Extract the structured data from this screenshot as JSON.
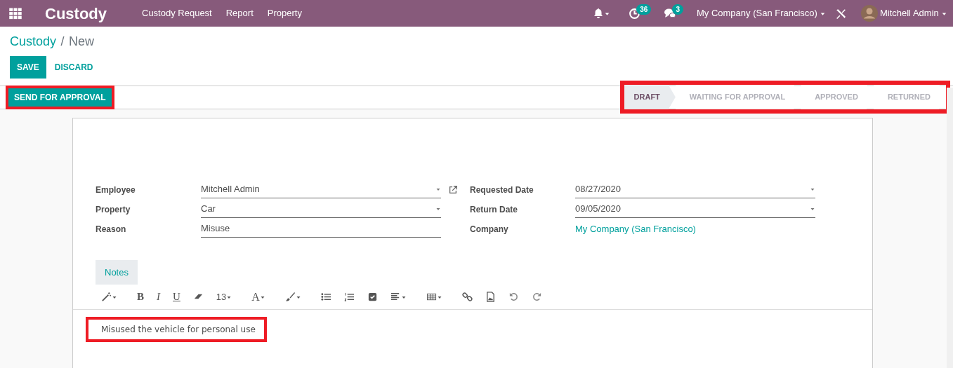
{
  "navbar": {
    "app_title": "Custody",
    "menu": [
      "Custody Request",
      "Report",
      "Property"
    ],
    "activity_count": "36",
    "message_count": "3",
    "company": "My Company (San Francisco)",
    "user": "Mitchell Admin"
  },
  "breadcrumb": {
    "parent": "Custody",
    "separator": "/",
    "current": "New"
  },
  "actions": {
    "save": "SAVE",
    "discard": "DISCARD"
  },
  "statusbar": {
    "button": "SEND FOR APPROVAL",
    "stages": [
      {
        "label": "DRAFT",
        "selected": true
      },
      {
        "label": "WAITING FOR APPROVAL",
        "selected": false
      },
      {
        "label": "APPROVED",
        "selected": false
      },
      {
        "label": "RETURNED",
        "selected": false
      }
    ]
  },
  "form": {
    "left": [
      {
        "label": "Employee",
        "value": "Mitchell Admin",
        "kind": "record"
      },
      {
        "label": "Property",
        "value": "Car",
        "kind": "select"
      },
      {
        "label": "Reason",
        "value": "Misuse",
        "kind": "text"
      }
    ],
    "right": [
      {
        "label": "Requested Date",
        "value": "08/27/2020",
        "kind": "date"
      },
      {
        "label": "Return Date",
        "value": "09/05/2020",
        "kind": "date"
      },
      {
        "label": "Company",
        "value": "My Company (San Francisco)",
        "kind": "link"
      }
    ]
  },
  "notes": {
    "tab": "Notes",
    "toolbar": [
      {
        "kind": "icon"
      },
      {
        "kind": "text",
        "text": "B"
      },
      {
        "kind": "text",
        "text": "I"
      },
      {
        "kind": "text",
        "text": "U"
      },
      {
        "kind": "icon"
      },
      {
        "kind": "text",
        "text": "13"
      },
      {
        "kind": "text",
        "text": "A"
      },
      {
        "kind": "icon"
      },
      {
        "kind": "icon"
      },
      {
        "kind": "icon"
      },
      {
        "kind": "icon"
      },
      {
        "kind": "icon"
      },
      {
        "kind": "icon"
      },
      {
        "kind": "icon"
      },
      {
        "kind": "icon"
      },
      {
        "kind": "icon"
      },
      {
        "kind": "icon"
      }
    ],
    "content": "Misused the vehicle for personal use"
  }
}
